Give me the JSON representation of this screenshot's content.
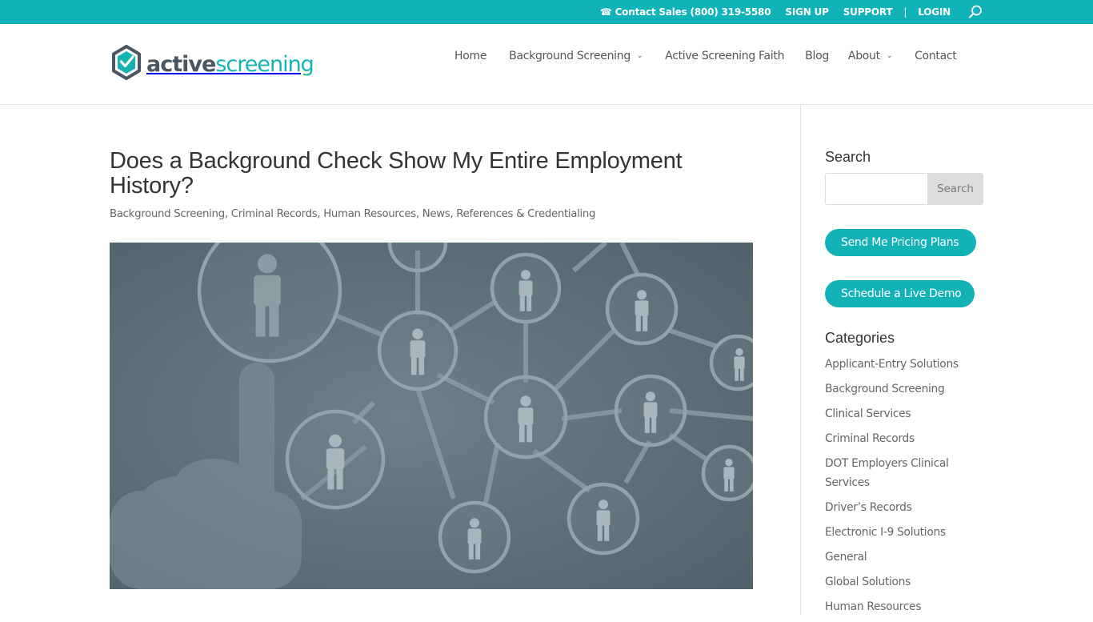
{
  "topbar": {
    "contact": "☎ Contact Sales (800) 319-5580",
    "signup": "SIGN UP",
    "support": "SUPPORT",
    "separator": "|",
    "login": "LOGIN",
    "search_icon": "search-icon"
  },
  "brand": {
    "name_part1": "active",
    "name_part2": "screening",
    "logo_icon": "hexagon-check-icon",
    "accent_color": "#0fb3b8",
    "dark_color": "#4a5660"
  },
  "nav": {
    "items": [
      {
        "label": "Home",
        "has_dropdown": false
      },
      {
        "label": "Background Screening",
        "has_dropdown": true
      },
      {
        "label": "Active Screening Faith",
        "has_dropdown": false
      },
      {
        "label": "Blog",
        "has_dropdown": false
      },
      {
        "label": "About",
        "has_dropdown": true
      },
      {
        "label": "Contact",
        "has_dropdown": false
      }
    ],
    "chevron": "⌄"
  },
  "post": {
    "title": "Does a Background Check Show My Entire Employment History?",
    "categories": [
      "Background Screening",
      "Criminal Records",
      "Human Resources",
      "News",
      "References & Credentialing"
    ],
    "separator": ", ",
    "image_alt": "Hand touching a network of connected people icons"
  },
  "sidebar": {
    "search": {
      "title": "Search",
      "placeholder": "",
      "value": "",
      "button_label": "Search"
    },
    "cta": {
      "pricing_label": "Send Me Pricing Plans",
      "demo_label": "Schedule a Live Demo"
    },
    "categories": {
      "title": "Categories",
      "items": [
        "Applicant-Entry Solutions",
        "Background Screening",
        "Clinical Services",
        "Criminal Records",
        "DOT Employers Clinical Services",
        "Driver’s Records",
        "Electronic I-9 Solutions",
        "General",
        "Global Solutions",
        "Human Resources"
      ]
    }
  }
}
